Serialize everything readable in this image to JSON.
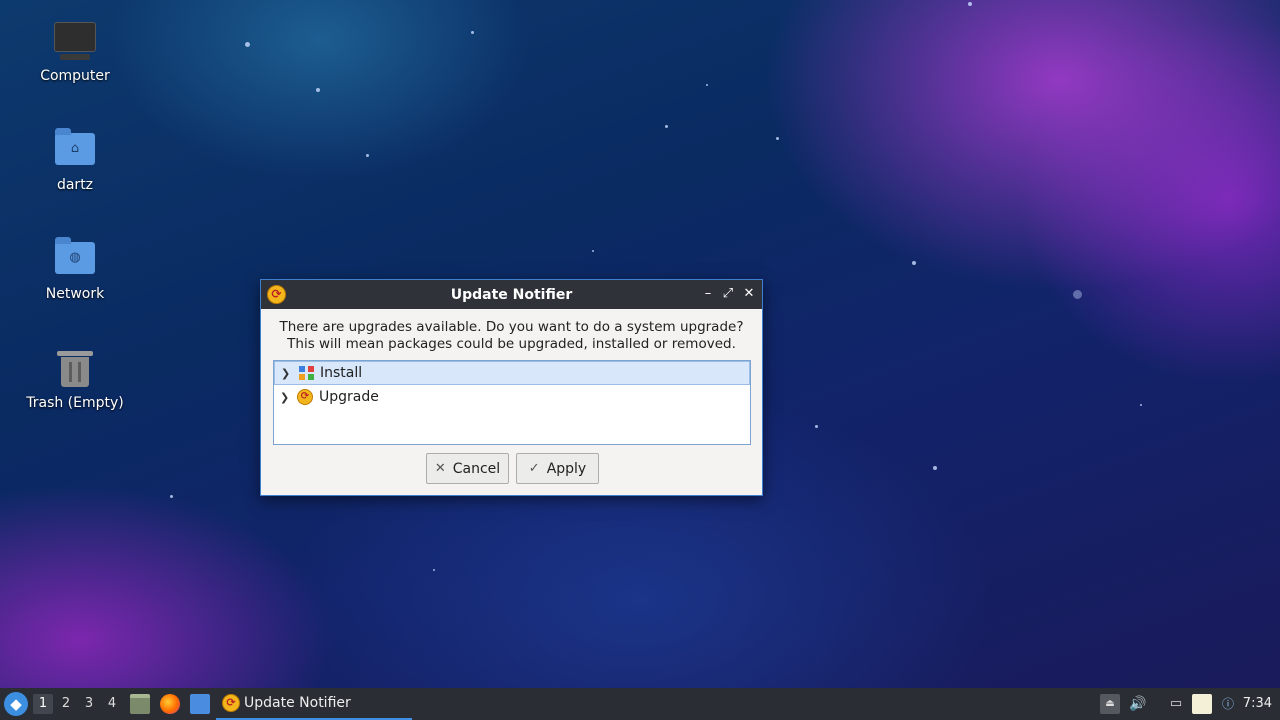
{
  "desktop": {
    "icons": [
      {
        "label": "Computer",
        "icon": "computer-icon"
      },
      {
        "label": "dartz",
        "icon": "home-folder-icon"
      },
      {
        "label": "Network",
        "icon": "network-folder-icon"
      },
      {
        "label": "Trash (Empty)",
        "icon": "trash-icon"
      }
    ]
  },
  "dialog": {
    "title": "Update Notifier",
    "message_line1": "There are upgrades available. Do you want to do a system upgrade?",
    "message_line2": "This will mean packages could be upgraded, installed or removed.",
    "tree_items": [
      {
        "label": "Install",
        "icon": "install-icon",
        "selected": true
      },
      {
        "label": "Upgrade",
        "icon": "upgrade-icon",
        "selected": false
      }
    ],
    "cancel_label": "Cancel",
    "apply_label": "Apply",
    "controls": {
      "minimize": "–",
      "maximize": "⤢",
      "close": "✕"
    }
  },
  "taskbar": {
    "workspaces": [
      "1",
      "2",
      "3",
      "4"
    ],
    "active_workspace": "1",
    "task_label": "Update Notifier",
    "clock": "7:34"
  },
  "colors": {
    "accent": "#3f8fe6",
    "titlebar": "#2f3238",
    "taskbar": "#2a2d33"
  }
}
